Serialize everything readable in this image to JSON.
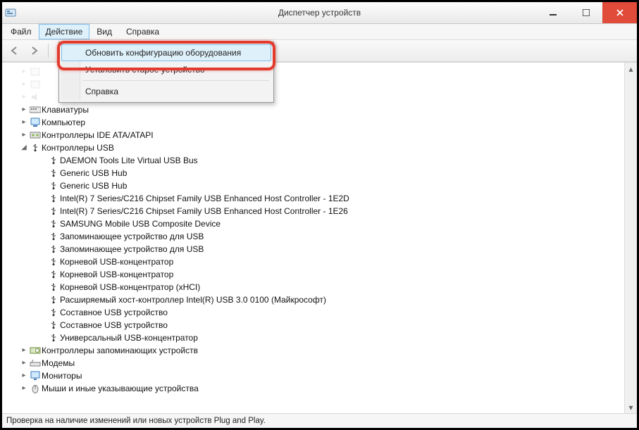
{
  "window": {
    "title": "Диспетчер устройств"
  },
  "menubar": {
    "items": [
      {
        "label": "Файл"
      },
      {
        "label": "Действие",
        "open": true
      },
      {
        "label": "Вид"
      },
      {
        "label": "Справка"
      }
    ]
  },
  "dropdown": {
    "items": [
      {
        "label": "Обновить конфигурацию оборудования",
        "highlighted": true
      },
      {
        "label": "Установить старое устройство"
      }
    ],
    "post_sep_items": [
      {
        "label": "Справка"
      }
    ]
  },
  "toolbar": {
    "back_icon": "back",
    "fwd_icon": "fwd"
  },
  "tree": {
    "obscured": [
      {
        "label": "",
        "icon": "device"
      },
      {
        "label": "",
        "icon": "device"
      },
      {
        "label": "",
        "icon": "audio"
      }
    ],
    "top_categories": [
      {
        "label": "Клавиатуры",
        "icon": "keyboard"
      },
      {
        "label": "Компьютер",
        "icon": "computer"
      },
      {
        "label": "Контроллеры IDE ATA/ATAPI",
        "icon": "ide"
      }
    ],
    "usb_category_label": "Контроллеры USB",
    "usb_children": [
      "DAEMON Tools Lite Virtual USB Bus",
      "Generic USB Hub",
      "Generic USB Hub",
      "Intel(R) 7 Series/C216 Chipset Family USB Enhanced Host Controller - 1E2D",
      "Intel(R) 7 Series/C216 Chipset Family USB Enhanced Host Controller - 1E26",
      "SAMSUNG Mobile USB Composite Device",
      "Запоминающее устройство для USB",
      "Запоминающее устройство для USB",
      "Корневой USB-концентратор",
      "Корневой USB-концентратор",
      "Корневой USB-концентратор (xHCI)",
      "Расширяемый хост-контроллер Intel(R) USB 3.0 0100 (Майкрософт)",
      "Составное USB устройство",
      "Составное USB устройство",
      "Универсальный USB-концентратор"
    ],
    "bottom_categories": [
      {
        "label": "Контроллеры запоминающих устройств",
        "icon": "storage"
      },
      {
        "label": "Модемы",
        "icon": "modem"
      },
      {
        "label": "Мониторы",
        "icon": "monitor"
      },
      {
        "label": "Мыши и иные указывающие устройства",
        "icon": "mouse"
      }
    ]
  },
  "statusbar": {
    "text": "Проверка на наличие изменений или новых устройств Plug and Play."
  }
}
